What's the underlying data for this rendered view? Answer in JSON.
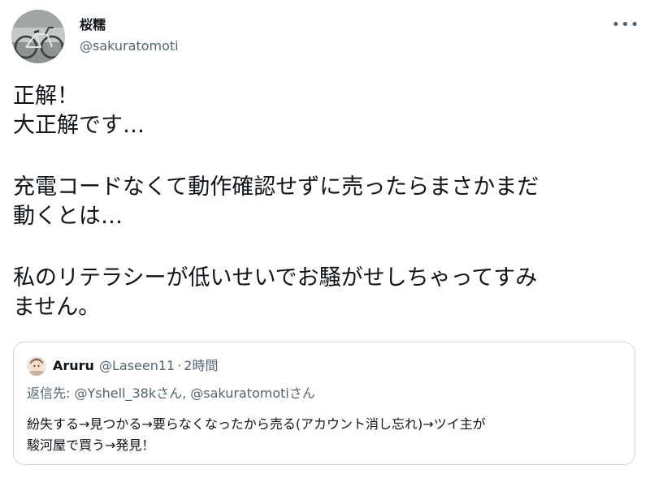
{
  "tweet": {
    "display_name": "桜糯",
    "handle": "@sakuratomoti",
    "more_label": "•••",
    "body_lines": [
      "正解！",
      "大正解です…",
      "",
      "充電コードなくて動作確認せずに売ったらまさかまだ",
      "動くとは…",
      "",
      "私のリテラシーが低いせいでお騒がせしちゃってすみ",
      "ません。"
    ]
  },
  "quote": {
    "display_name": "Aruru",
    "handle": "@Laseen11",
    "separator": "·",
    "time": "2時間",
    "reply_prefix": "返信先: ",
    "reply_mention_1": "@Yshell_38k",
    "reply_suffix_1": "さん, ",
    "reply_mention_2": "@sakuratomoti",
    "reply_suffix_2": "さん",
    "text_lines": [
      "紛失する→見つかる→要らなくなったから売る(アカウント消し忘れ)→ツイ主が",
      "駿河屋で買う→発見！"
    ]
  },
  "colors": {
    "text": "#0f1419",
    "secondary": "#536471",
    "border": "#cfd9de"
  }
}
